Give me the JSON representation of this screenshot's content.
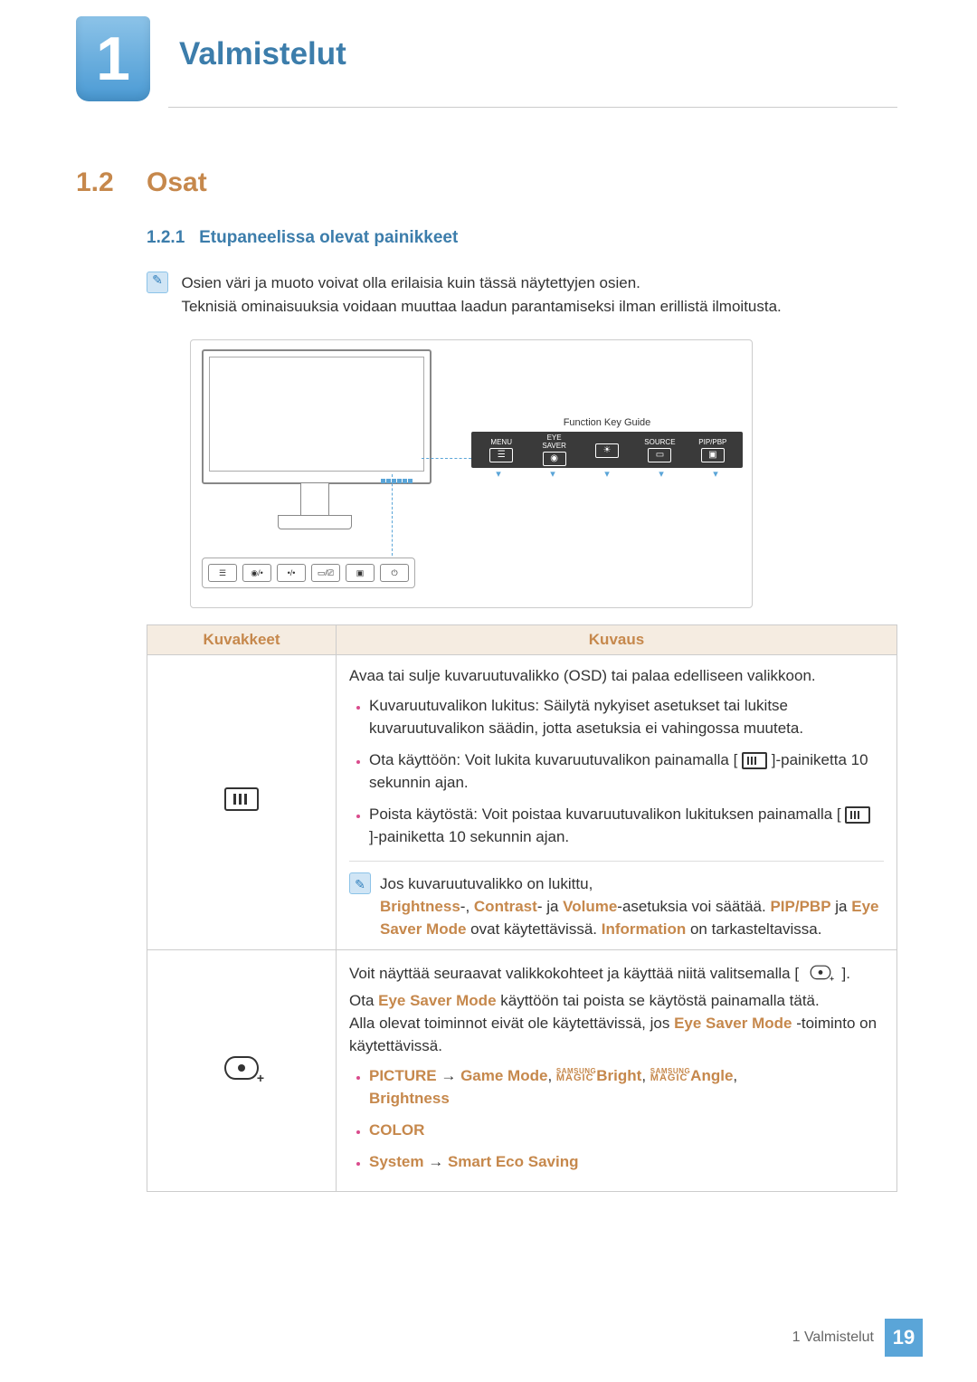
{
  "chapter": {
    "number": "1",
    "title": "Valmistelut"
  },
  "section": {
    "number": "1.2",
    "title": "Osat"
  },
  "subsection": {
    "number": "1.2.1",
    "title": "Etupaneelissa olevat painikkeet"
  },
  "note": {
    "line1": "Osien väri ja muoto voivat olla erilaisia kuin tässä näytettyjen osien.",
    "line2": "Teknisiä ominaisuuksia voidaan muuttaa laadun parantamiseksi ilman erillistä ilmoitusta."
  },
  "diagram": {
    "function_key_guide_label": "Function Key Guide",
    "keys": [
      {
        "label": "MENU"
      },
      {
        "label": "EYE\nSAVER"
      },
      {
        "label": ""
      },
      {
        "label": "SOURCE"
      },
      {
        "label": "PIP/PBP"
      }
    ]
  },
  "table": {
    "headers": {
      "icons": "Kuvakkeet",
      "desc": "Kuvaus"
    },
    "row1": {
      "intro": "Avaa tai sulje kuvaruutuvalikko (OSD) tai palaa edelliseen valikkoon.",
      "b1": "Kuvaruutuvalikon lukitus: Säilytä nykyiset asetukset tai lukitse kuvaruutuvalikon säädin, jotta asetuksia ei vahingossa muuteta.",
      "b2a": "Ota käyttöön: Voit lukita kuvaruutuvalikon painamalla [ ",
      "b2b": " ]-painiketta 10 sekunnin ajan.",
      "b3a": "Poista käytöstä: Voit poistaa kuvaruutuvalikon lukituksen painamalla [ ",
      "b3b": " ]-painiketta 10 sekunnin ajan.",
      "note_lead": "Jos kuvaruutuvalikko on lukittu,",
      "note_body_1": "Brightness",
      "note_body_2": "-, ",
      "note_body_3": "Contrast",
      "note_body_4": "- ja ",
      "note_body_5": "Volume",
      "note_body_6": "-asetuksia voi säätää. ",
      "note_body_7": "PIP/PBP",
      "note_body_8": " ja ",
      "note_body_9": "Eye Saver Mode",
      "note_body_10": " ovat käytettävissä. ",
      "note_body_11": "Information",
      "note_body_12": " on tarkasteltavissa."
    },
    "row2": {
      "l1a": "Voit näyttää seuraavat valikkokohteet ja käyttää niitä valitsemalla [ ",
      "l1b": " ].",
      "l2a": "Ota ",
      "l2b": "Eye Saver Mode",
      "l2c": " käyttöön tai poista se käytöstä painamalla tätä.",
      "l3a": "Alla olevat toiminnot eivät ole käytettävissä, jos ",
      "l3b": "Eye Saver Mode",
      "l3c": " -toiminto on käytettävissä.",
      "b1": {
        "picture": "PICTURE",
        "arrow": " → ",
        "game": "Game Mode",
        "comma": ", ",
        "bright": "Bright",
        "angle": "Angle",
        "brightness": "Brightness"
      },
      "b2": "COLOR",
      "b3": {
        "system": "System",
        "arrow": " → ",
        "ses": "Smart Eco Saving"
      }
    }
  },
  "footer": {
    "text": "1 Valmistelut",
    "page": "19"
  }
}
